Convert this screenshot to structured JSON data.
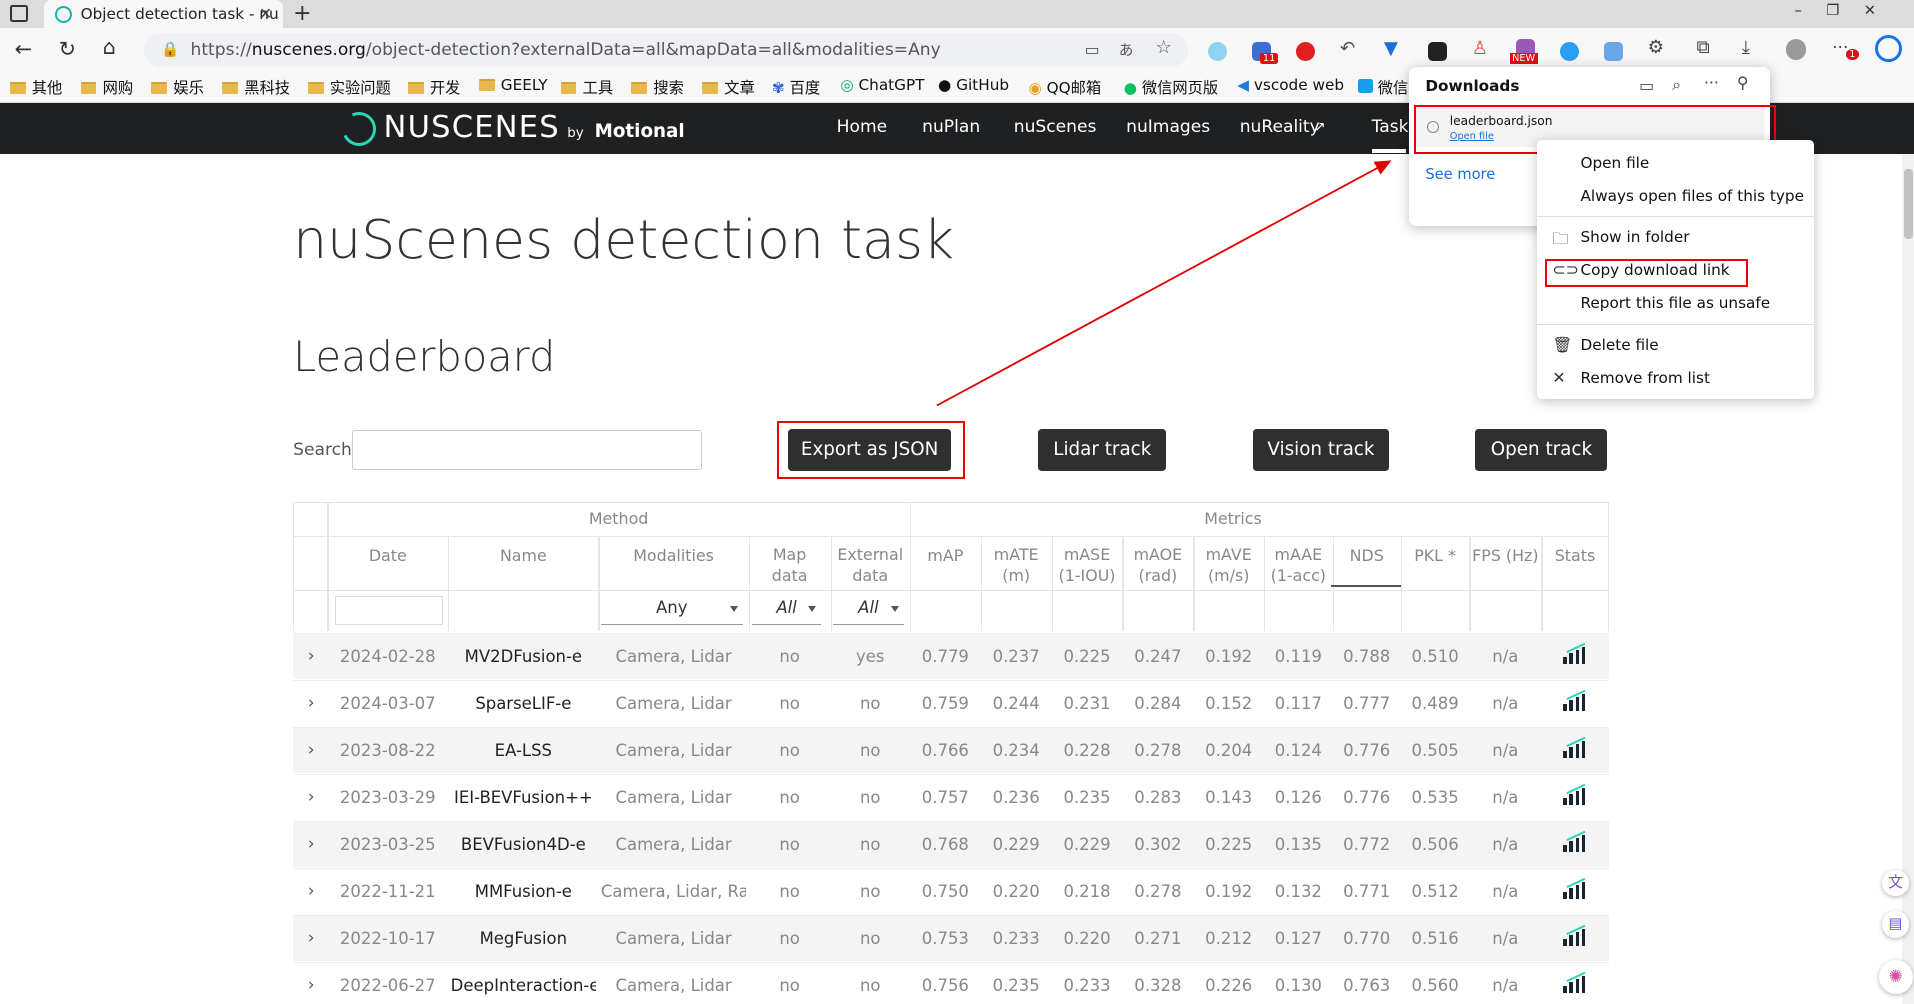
{
  "browser": {
    "tab_title": "Object detection task - nu",
    "url_prefix": "https://",
    "url_domain": "nuscenes.org",
    "url_path": "/object-detection?externalData=all&mapData=all&modalities=Any",
    "new_badge": "NEW",
    "ext_badge": "11",
    "profile_badge": "1",
    "bookmarks": [
      "其他",
      "网购",
      "娱乐",
      "黑科技",
      "实验问题",
      "开发",
      "GEELY",
      "工具",
      "搜索",
      "文章",
      "百度",
      "ChatGPT",
      "GitHub",
      "QQ邮箱",
      "微信网页版",
      "vscode web",
      "微信"
    ]
  },
  "site": {
    "brand": "NUSCENES",
    "brand_by": "by",
    "brand_company": "Motional",
    "nav": [
      "Home",
      "nuPlan",
      "nuScenes",
      "nuImages",
      "nuReality",
      "Tasks"
    ]
  },
  "page": {
    "title": "nuScenes detection task",
    "subtitle": "Leaderboard",
    "search_label": "Search:",
    "buttons": [
      "Export as JSON",
      "Lidar track",
      "Vision track",
      "Open track"
    ]
  },
  "table": {
    "group_method": "Method",
    "group_metrics": "Metrics",
    "headers": [
      [
        "Date"
      ],
      [
        "Name"
      ],
      [
        "Modalities"
      ],
      [
        "Map",
        "data"
      ],
      [
        "External",
        "data"
      ],
      [
        "mAP"
      ],
      [
        "mATE",
        "(m)"
      ],
      [
        "mASE",
        "(1-IOU)"
      ],
      [
        "mAOE",
        "(rad)"
      ],
      [
        "mAVE",
        "(m/s)"
      ],
      [
        "mAAE",
        "(1-acc)"
      ],
      [
        "NDS"
      ],
      [
        "PKL *"
      ],
      [
        "FPS (Hz)"
      ],
      [
        "Stats"
      ]
    ],
    "filters": {
      "modalities": "Any",
      "map": "All",
      "external": "All"
    },
    "rows": [
      [
        "2024-02-28",
        "MV2DFusion-e",
        "Camera, Lidar",
        "no",
        "yes",
        "0.779",
        "0.237",
        "0.225",
        "0.247",
        "0.192",
        "0.119",
        "0.788",
        "0.510",
        "n/a"
      ],
      [
        "2024-03-07",
        "SparseLIF-e",
        "Camera, Lidar",
        "no",
        "no",
        "0.759",
        "0.244",
        "0.231",
        "0.284",
        "0.152",
        "0.117",
        "0.777",
        "0.489",
        "n/a"
      ],
      [
        "2023-08-22",
        "EA-LSS",
        "Camera, Lidar",
        "no",
        "no",
        "0.766",
        "0.234",
        "0.228",
        "0.278",
        "0.204",
        "0.124",
        "0.776",
        "0.505",
        "n/a"
      ],
      [
        "2023-03-29",
        "IEI-BEVFusion++",
        "Camera, Lidar",
        "no",
        "no",
        "0.757",
        "0.236",
        "0.235",
        "0.283",
        "0.143",
        "0.126",
        "0.776",
        "0.535",
        "n/a"
      ],
      [
        "2023-03-25",
        "BEVFusion4D-e",
        "Camera, Lidar",
        "no",
        "no",
        "0.768",
        "0.229",
        "0.229",
        "0.302",
        "0.225",
        "0.135",
        "0.772",
        "0.506",
        "n/a"
      ],
      [
        "2022-11-21",
        "MMFusion-e",
        "Camera, Lidar, Radi",
        "no",
        "no",
        "0.750",
        "0.220",
        "0.218",
        "0.278",
        "0.192",
        "0.132",
        "0.771",
        "0.512",
        "n/a"
      ],
      [
        "2022-10-17",
        "MegFusion",
        "Camera, Lidar",
        "no",
        "no",
        "0.753",
        "0.233",
        "0.220",
        "0.271",
        "0.212",
        "0.127",
        "0.770",
        "0.516",
        "n/a"
      ],
      [
        "2022-06-27",
        "DeepInteraction-e",
        "Camera, Lidar",
        "no",
        "no",
        "0.756",
        "0.235",
        "0.233",
        "0.328",
        "0.226",
        "0.130",
        "0.763",
        "0.560",
        "n/a"
      ]
    ]
  },
  "downloads": {
    "title": "Downloads",
    "file_name": "leaderboard.json",
    "file_action": "Open file",
    "see_more": "See more"
  },
  "context_menu": {
    "open_file": "Open file",
    "always_open": "Always open files of this type",
    "show_in_folder": "Show in folder",
    "copy_link": "Copy download link",
    "report_unsafe": "Report this file as unsafe",
    "delete_file": "Delete file",
    "remove_from_list": "Remove from list"
  },
  "colors": {
    "accent": "#2bd5b7",
    "annotation": "#e00000",
    "nav_bg": "#1f2021",
    "button_bg": "#2f2f2f"
  }
}
